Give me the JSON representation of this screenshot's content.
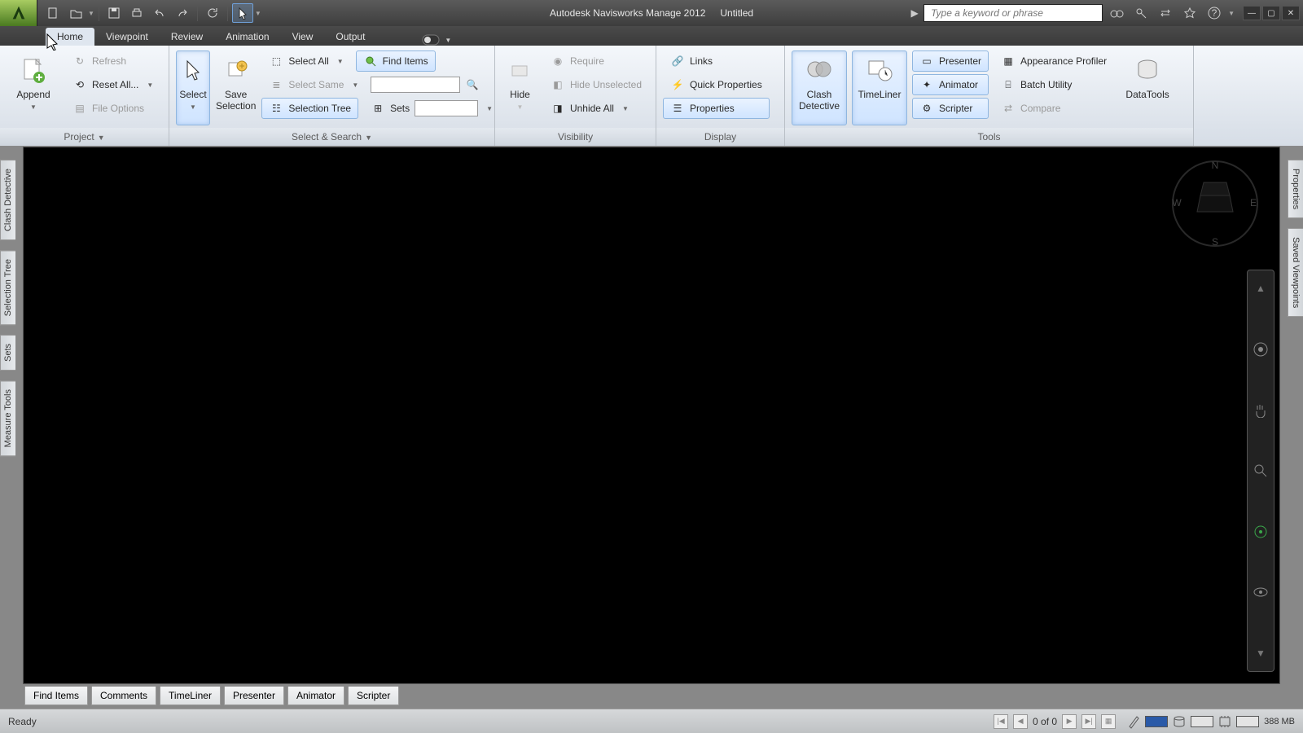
{
  "title": {
    "app": "Autodesk Navisworks Manage 2012",
    "doc": "Untitled"
  },
  "infocenter": {
    "placeholder": "Type a keyword or phrase"
  },
  "tabs": {
    "home": "Home",
    "viewpoint": "Viewpoint",
    "review": "Review",
    "animation": "Animation",
    "view": "View",
    "output": "Output"
  },
  "ribbon": {
    "project": {
      "title": "Project",
      "append": "Append",
      "refresh": "Refresh",
      "reset_all": "Reset All...",
      "file_options": "File Options"
    },
    "select_search": {
      "title": "Select & Search",
      "select": "Select",
      "save_selection": "Save\nSelection",
      "select_all": "Select All",
      "select_same": "Select Same",
      "selection_tree": "Selection Tree",
      "find_items": "Find Items",
      "sets": "Sets"
    },
    "visibility": {
      "title": "Visibility",
      "hide": "Hide",
      "require": "Require",
      "hide_unselected": "Hide Unselected",
      "unhide_all": "Unhide All"
    },
    "display": {
      "title": "Display",
      "links": "Links",
      "quick_properties": "Quick Properties",
      "properties": "Properties"
    },
    "tools": {
      "title": "Tools",
      "clash_detective": "Clash\nDetective",
      "timeliner": "TimeLiner",
      "presenter": "Presenter",
      "animator": "Animator",
      "scripter": "Scripter",
      "appearance_profiler": "Appearance Profiler",
      "batch_utility": "Batch Utility",
      "compare": "Compare",
      "datatools": "DataTools"
    }
  },
  "left_docks": [
    "Clash Detective",
    "Selection Tree",
    "Sets",
    "Measure Tools"
  ],
  "right_docks": [
    "Properties",
    "Saved Viewpoints"
  ],
  "bottom_tabs": [
    "Find Items",
    "Comments",
    "TimeLiner",
    "Presenter",
    "Animator",
    "Scripter"
  ],
  "status": {
    "ready": "Ready",
    "pager": "0 of 0",
    "mem": "388 MB"
  },
  "viewcube": {
    "n": "N",
    "e": "E",
    "s": "S",
    "w": "W"
  }
}
